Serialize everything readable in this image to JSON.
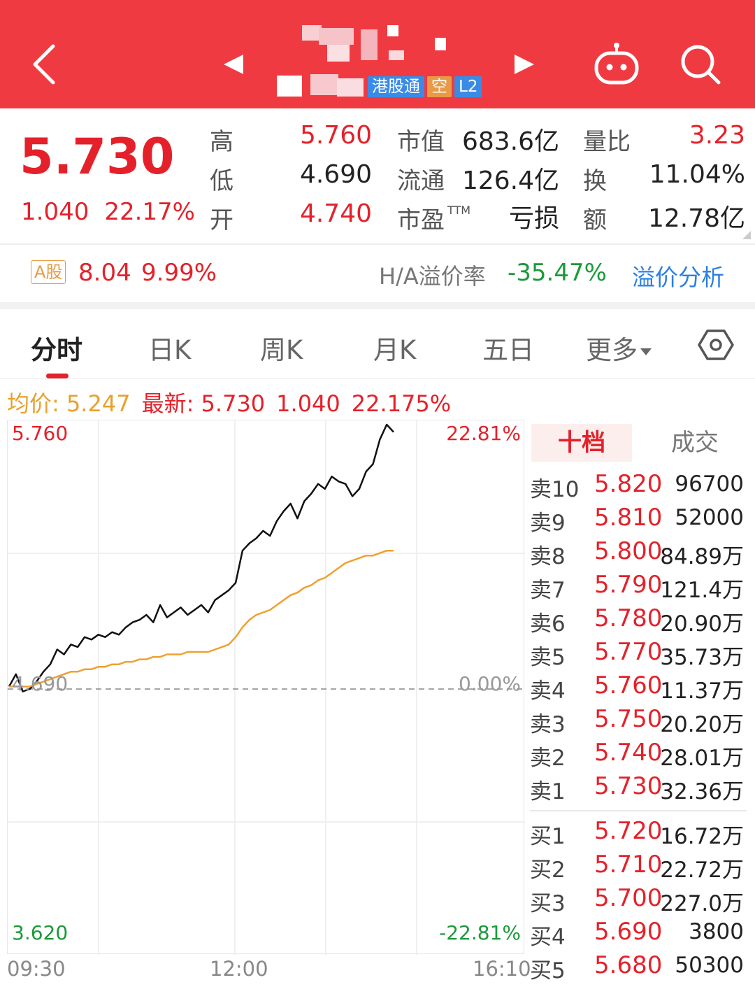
{
  "header": {
    "tags": [
      {
        "label": "港股通",
        "color": "#3a8be6"
      },
      {
        "label": "空",
        "color": "#e89a45"
      },
      {
        "label": "L2",
        "color": "#3a8be6"
      }
    ],
    "background": "#f03a42"
  },
  "quote": {
    "price": "5.730",
    "change": "1.040",
    "change_pct": "22.17%",
    "high_label": "高",
    "high": "5.760",
    "low_label": "低",
    "low": "4.690",
    "open_label": "开",
    "open": "4.740",
    "mktcap_label": "市值",
    "mktcap": "683.6亿",
    "float_label": "流通",
    "float": "126.4亿",
    "pe_label": "市盈",
    "pe_sup": "TTM",
    "pe": "亏损",
    "volratio_label": "量比",
    "volratio": "3.23",
    "turnover_label": "换",
    "turnover": "11.04%",
    "amount_label": "额",
    "amount": "12.78亿"
  },
  "ashare": {
    "badge": "A股",
    "price": "8.04",
    "pct": "9.99%",
    "premium_label": "H/A溢价率",
    "premium": "-35.47%",
    "analysis_link": "溢价分析"
  },
  "tabs": [
    "分时",
    "日K",
    "周K",
    "月K",
    "五日",
    "更多"
  ],
  "info": {
    "avg_label": "均价:",
    "avg": "5.247",
    "latest_label": "最新:",
    "latest": "5.730",
    "latest_change": "1.040",
    "latest_pct": "22.175%"
  },
  "chart_labels": {
    "top_price": "5.760",
    "top_pct": "22.81%",
    "mid_price": "4.690",
    "mid_pct": "0.00%",
    "bottom_price": "3.620",
    "bottom_pct": "-22.81%",
    "time_start": "09:30",
    "time_mid": "12:00",
    "time_end": "16:10"
  },
  "chart_data": {
    "type": "line",
    "ylim": [
      3.62,
      5.76
    ],
    "reference": 4.69,
    "series": [
      {
        "color": "#111111",
        "values": [
          4.7,
          4.75,
          4.68,
          4.69,
          4.72,
          4.76,
          4.79,
          4.85,
          4.83,
          4.87,
          4.86,
          4.9,
          4.89,
          4.91,
          4.9,
          4.92,
          4.91,
          4.94,
          4.96,
          4.97,
          4.99,
          4.96,
          5.03,
          4.98,
          5.0,
          5.02,
          4.99,
          5.01,
          5.03,
          5.0,
          5.05,
          5.07,
          5.09,
          5.12,
          5.25,
          5.28,
          5.3,
          5.33,
          5.31,
          5.37,
          5.41,
          5.44,
          5.38,
          5.45,
          5.48,
          5.52,
          5.5,
          5.55,
          5.53,
          5.52,
          5.47,
          5.5,
          5.57,
          5.6,
          5.7,
          5.76,
          5.73
        ]
      },
      {
        "color": "#f0a030",
        "values": [
          4.7,
          4.7,
          4.7,
          4.7,
          4.71,
          4.72,
          4.73,
          4.74,
          4.75,
          4.76,
          4.76,
          4.77,
          4.77,
          4.78,
          4.78,
          4.79,
          4.79,
          4.8,
          4.8,
          4.81,
          4.81,
          4.82,
          4.82,
          4.83,
          4.83,
          4.83,
          4.84,
          4.84,
          4.84,
          4.84,
          4.85,
          4.86,
          4.87,
          4.9,
          4.94,
          4.97,
          4.99,
          5.0,
          5.01,
          5.03,
          5.05,
          5.07,
          5.08,
          5.1,
          5.11,
          5.13,
          5.14,
          5.16,
          5.18,
          5.2,
          5.21,
          5.22,
          5.23,
          5.23,
          5.24,
          5.25,
          5.25
        ]
      }
    ]
  },
  "orderbook": {
    "tabs": [
      "十档",
      "成交"
    ],
    "asks": [
      {
        "label": "卖10",
        "price": "5.820",
        "vol": "96700"
      },
      {
        "label": "卖9",
        "price": "5.810",
        "vol": "52000"
      },
      {
        "label": "卖8",
        "price": "5.800",
        "vol": "84.89万"
      },
      {
        "label": "卖7",
        "price": "5.790",
        "vol": "121.4万"
      },
      {
        "label": "卖6",
        "price": "5.780",
        "vol": "20.90万"
      },
      {
        "label": "卖5",
        "price": "5.770",
        "vol": "35.73万"
      },
      {
        "label": "卖4",
        "price": "5.760",
        "vol": "11.37万"
      },
      {
        "label": "卖3",
        "price": "5.750",
        "vol": "20.20万"
      },
      {
        "label": "卖2",
        "price": "5.740",
        "vol": "28.01万"
      },
      {
        "label": "卖1",
        "price": "5.730",
        "vol": "32.36万"
      }
    ],
    "bids": [
      {
        "label": "买1",
        "price": "5.720",
        "vol": "16.72万"
      },
      {
        "label": "买2",
        "price": "5.710",
        "vol": "22.72万"
      },
      {
        "label": "买3",
        "price": "5.700",
        "vol": "227.0万"
      },
      {
        "label": "买4",
        "price": "5.690",
        "vol": "3800"
      },
      {
        "label": "买5",
        "price": "5.680",
        "vol": "50300"
      }
    ]
  }
}
